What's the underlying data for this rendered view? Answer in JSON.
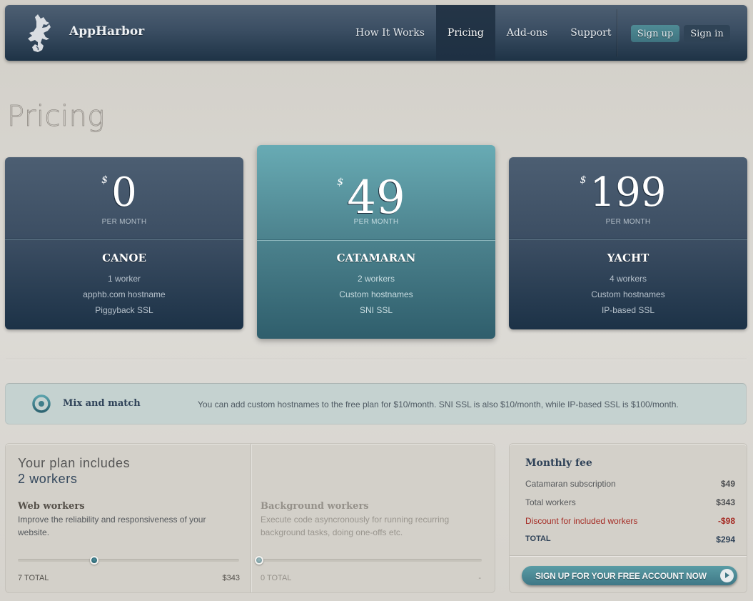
{
  "header": {
    "brand": "AppHarbor",
    "logo_icon": "seahorse-dragon-logo-icon",
    "nav": [
      {
        "label": "How It Works",
        "active": false
      },
      {
        "label": "Pricing",
        "active": true
      },
      {
        "label": "Add-ons",
        "active": false
      },
      {
        "label": "Support",
        "active": false
      }
    ],
    "sign_up_label": "Sign up",
    "sign_in_label": "Sign in"
  },
  "page_title": "Pricing",
  "plans": [
    {
      "currency": "$",
      "amount": "0",
      "period": "PER MONTH",
      "name": "CANOE",
      "features": [
        "1 worker",
        "apphb.com hostname",
        "Piggyback SSL"
      ],
      "featured": false
    },
    {
      "currency": "$",
      "amount": "49",
      "period": "PER MONTH",
      "name": "CATAMARAN",
      "features": [
        "2 workers",
        "Custom hostnames",
        "SNI SSL"
      ],
      "featured": true
    },
    {
      "currency": "$",
      "amount": "199",
      "period": "PER MONTH",
      "name": "YACHT",
      "features": [
        "4 workers",
        "Custom hostnames",
        "IP-based SSL"
      ],
      "featured": false
    }
  ],
  "mix": {
    "icon": "target-icon",
    "title": "Mix and match",
    "text": "You can add custom hostnames to the free plan for $10/month. SNI SSL is also $10/month, while IP-based SSL is $100/month."
  },
  "workers": {
    "includes_label": "Your plan includes",
    "includes_count": "2 workers",
    "web": {
      "title": "Web workers",
      "description": "Improve the reliability and responsiveness of your website.",
      "slider_fraction": 0.35,
      "total_label": "7 TOTAL",
      "price": "$343"
    },
    "background": {
      "title": "Background workers",
      "description": "Execute code asyncronously for running recurring background tasks, doing one-offs etc.",
      "slider_fraction": 0.0,
      "total_label": "0 TOTAL",
      "price": "-"
    }
  },
  "fee": {
    "title": "Monthly fee",
    "rows": [
      {
        "label": "Catamaran subscription",
        "value": "$49"
      },
      {
        "label": "Total workers",
        "value": "$343"
      },
      {
        "label": "Discount for included workers",
        "value": "-$98"
      },
      {
        "label": "TOTAL",
        "value": "$294"
      }
    ],
    "cta_label": "SIGN UP FOR YOUR FREE ACCOUNT NOW"
  },
  "colors": {
    "header_dark": "#1e3346",
    "accent_teal": "#4f8b95",
    "discount_red": "#a52b24"
  }
}
